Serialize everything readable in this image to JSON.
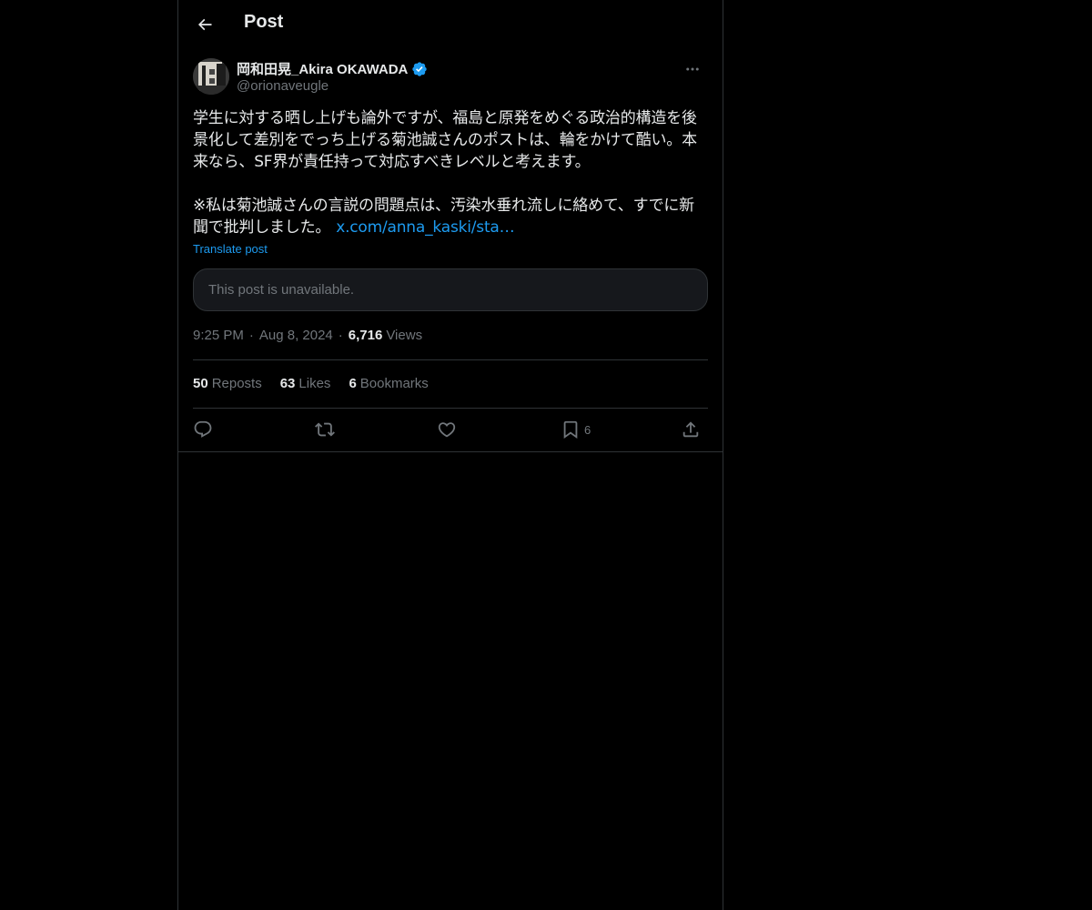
{
  "header": {
    "title": "Post"
  },
  "author": {
    "name": "岡和田晃_Akira OKAWADA",
    "handle": "@orionaveugle",
    "verified_color": "#1d9bf0"
  },
  "post": {
    "paragraph_1": "学生に対する晒し上げも論外ですが、福島と原発をめぐる政治的構造を後景化して差別をでっち上げる菊池誠さんのポストは、輪をかけて酷い。本来なら、SF界が責任持って対応すべきレベルと考えます。",
    "paragraph_2": "※私は菊池誠さんの言説の問題点は、汚染水垂れ流しに絡めて、すでに新聞で批判しました。",
    "link_text": "x.com/anna_kaski/sta…",
    "translate_label": "Translate post",
    "quote_unavailable": "This post is unavailable."
  },
  "meta": {
    "time": "9:25 PM",
    "date": "Aug 8, 2024",
    "views_count": "6,716",
    "views_label": "Views"
  },
  "stats": {
    "reposts_count": "50",
    "reposts_label": "Reposts",
    "likes_count": "63",
    "likes_label": "Likes",
    "bookmarks_count": "6",
    "bookmarks_label": "Bookmarks"
  },
  "actions": {
    "bookmark_count": "6"
  },
  "icons": {
    "back": "arrow-left-icon",
    "more": "more-dots-icon",
    "reply": "reply-icon",
    "repost": "repost-icon",
    "like": "heart-icon",
    "bookmark": "bookmark-icon",
    "share": "share-icon"
  },
  "colors": {
    "background": "#000000",
    "text": "#e7e9ea",
    "muted": "#71767b",
    "link": "#1d9bf0",
    "border": "#2f3336"
  }
}
